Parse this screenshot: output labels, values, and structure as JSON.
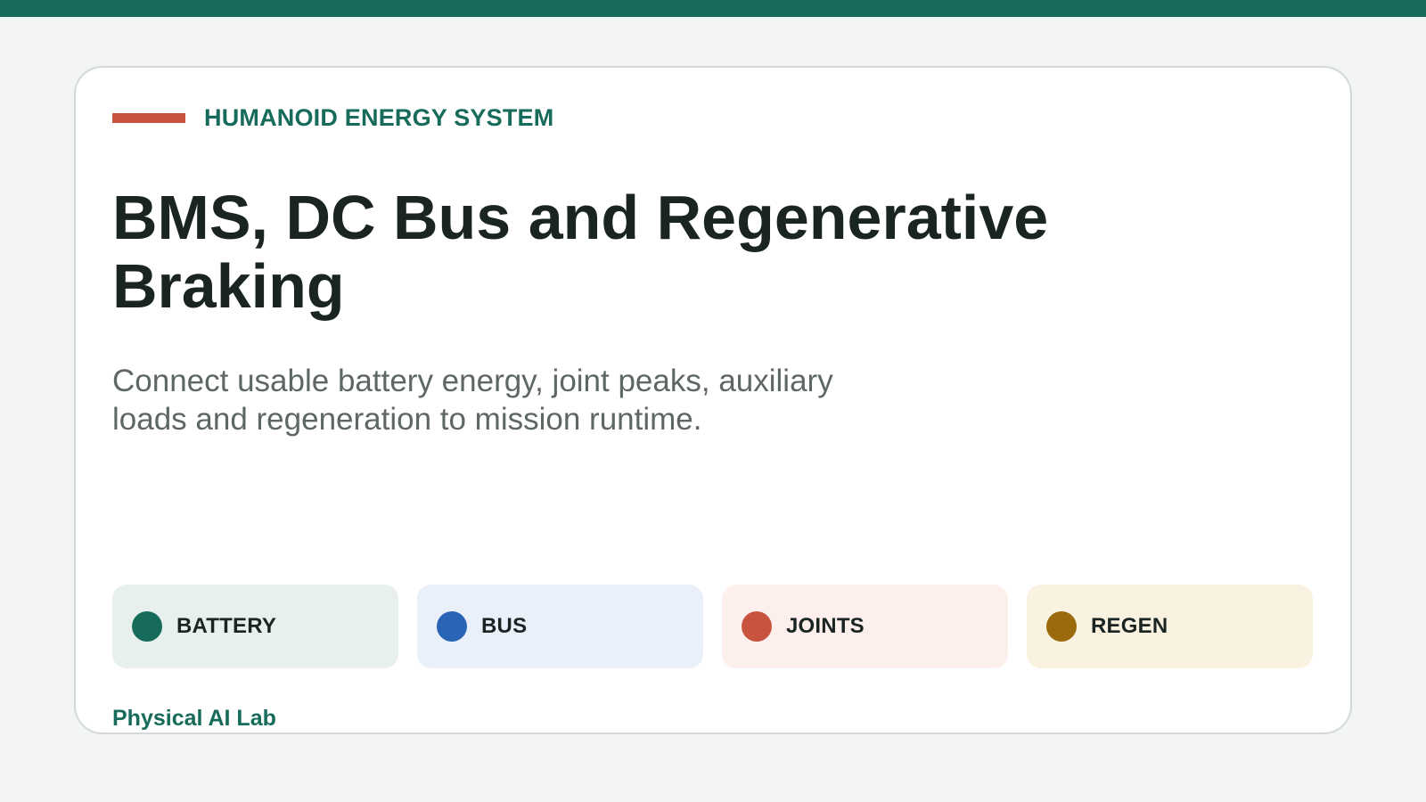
{
  "theme": {
    "primary": "#176b5a",
    "accent": "#c8533f",
    "text_dark": "#1a2423",
    "text_muted": "#5e6766"
  },
  "header": {
    "eyebrow": "HUMANOID ENERGY SYSTEM",
    "title": "BMS, DC Bus and Regenerative Braking",
    "subtitle": "Connect usable battery energy, joint peaks, auxiliary loads and regeneration to mission runtime."
  },
  "chips": [
    {
      "label": "BATTERY",
      "dot_color": "#176b5a",
      "bg_color": "#e7f0ec"
    },
    {
      "label": "BUS",
      "dot_color": "#2a65b5",
      "bg_color": "#e9f0fa"
    },
    {
      "label": "JOINTS",
      "dot_color": "#c8533f",
      "bg_color": "#fdf0ec"
    },
    {
      "label": "REGEN",
      "dot_color": "#9a6a0c",
      "bg_color": "#faf2e1"
    }
  ],
  "footer": {
    "brand": "Physical AI Lab"
  }
}
